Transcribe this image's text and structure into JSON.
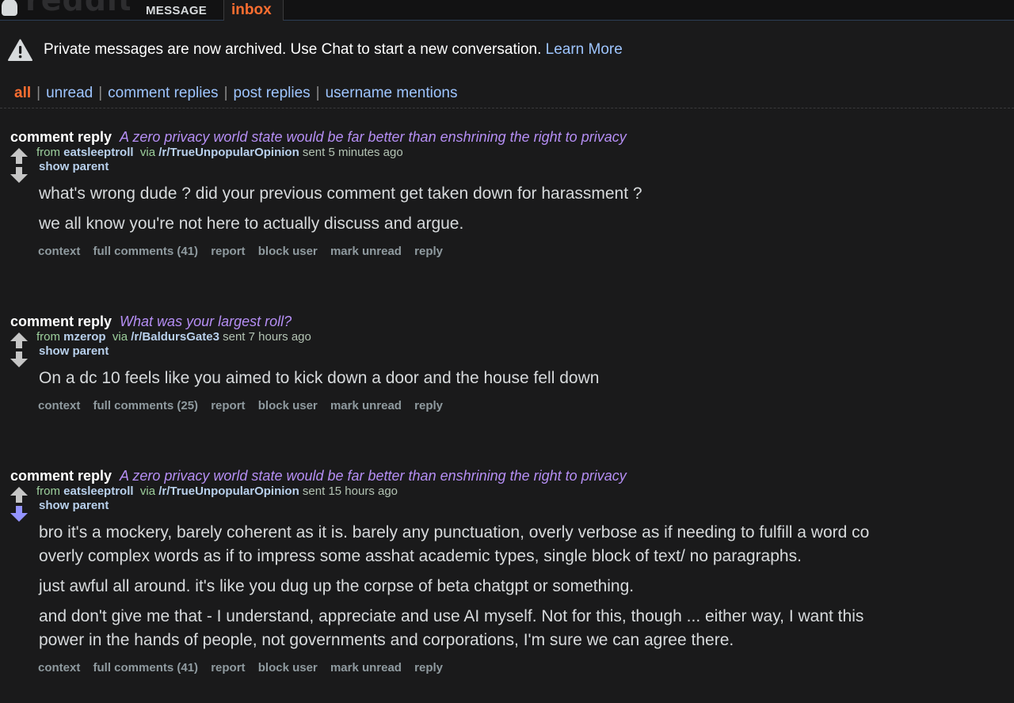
{
  "header": {
    "logo_text": "reddit",
    "tab_message": "MESSAGE",
    "tab_inbox": "inbox"
  },
  "notice": {
    "text": "Private messages are now archived. Use Chat to start a new conversation.",
    "link": "Learn More",
    "icon": "warning-icon"
  },
  "filters": {
    "all": "all",
    "unread": "unread",
    "comment_replies": "comment replies",
    "post_replies": "post replies",
    "username_mentions": "username mentions",
    "separator": "|"
  },
  "messages": [
    {
      "kind": "comment reply",
      "subject": "A zero privacy world state would be far better than enshrining the right to privacy",
      "from_label": "from",
      "author": "eatsleeptroll",
      "via_label": "via",
      "subreddit": "/r/TrueUnpopularOpinion",
      "time": "sent 5 minutes ago",
      "show_parent": "show parent",
      "body": [
        "what's wrong dude ? did your previous comment get taken down for harassment ?",
        "we all know you're not here to actually discuss and argue."
      ],
      "actions": [
        "context",
        "full comments (41)",
        "report",
        "block user",
        "mark unread",
        "reply"
      ],
      "vote": "none"
    },
    {
      "kind": "comment reply",
      "subject": "What was your largest roll?",
      "from_label": "from",
      "author": "mzerop",
      "via_label": "via",
      "subreddit": "/r/BaldursGate3",
      "time": "sent 7 hours ago",
      "show_parent": "show parent",
      "body": [
        "On a dc 10 feels like you aimed to kick down a door and the house fell down"
      ],
      "actions": [
        "context",
        "full comments (25)",
        "report",
        "block user",
        "mark unread",
        "reply"
      ],
      "vote": "none"
    },
    {
      "kind": "comment reply",
      "subject": "A zero privacy world state would be far better than enshrining the right to privacy",
      "from_label": "from",
      "author": "eatsleeptroll",
      "via_label": "via",
      "subreddit": "/r/TrueUnpopularOpinion",
      "time": "sent 15 hours ago",
      "show_parent": "show parent",
      "body": [
        "bro it's a mockery, barely coherent as it is. barely any punctuation, overly verbose as if needing to fulfill a word co",
        "overly complex words as if to impress some asshat academic types, single block of text/ no paragraphs.",
        "just awful all around. it's like you dug up the corpse of beta chatgpt or something.",
        "and don't give me that - I understand, appreciate and use AI myself. Not for this, though ... either way, I want this",
        "power in the hands of people, not governments and corporations, I'm sure we can agree there."
      ],
      "actions": [
        "context",
        "full comments (41)",
        "report",
        "block user",
        "mark unread",
        "reply"
      ],
      "vote": "downvoted"
    }
  ],
  "colors": {
    "background": "#1a1a1b",
    "accent_orange": "#ff6e30",
    "link_blue": "#9ec5ff",
    "subject_purple": "#b58ef4",
    "downvote": "#9494ff",
    "tagline_green": "#9ccf9c"
  }
}
